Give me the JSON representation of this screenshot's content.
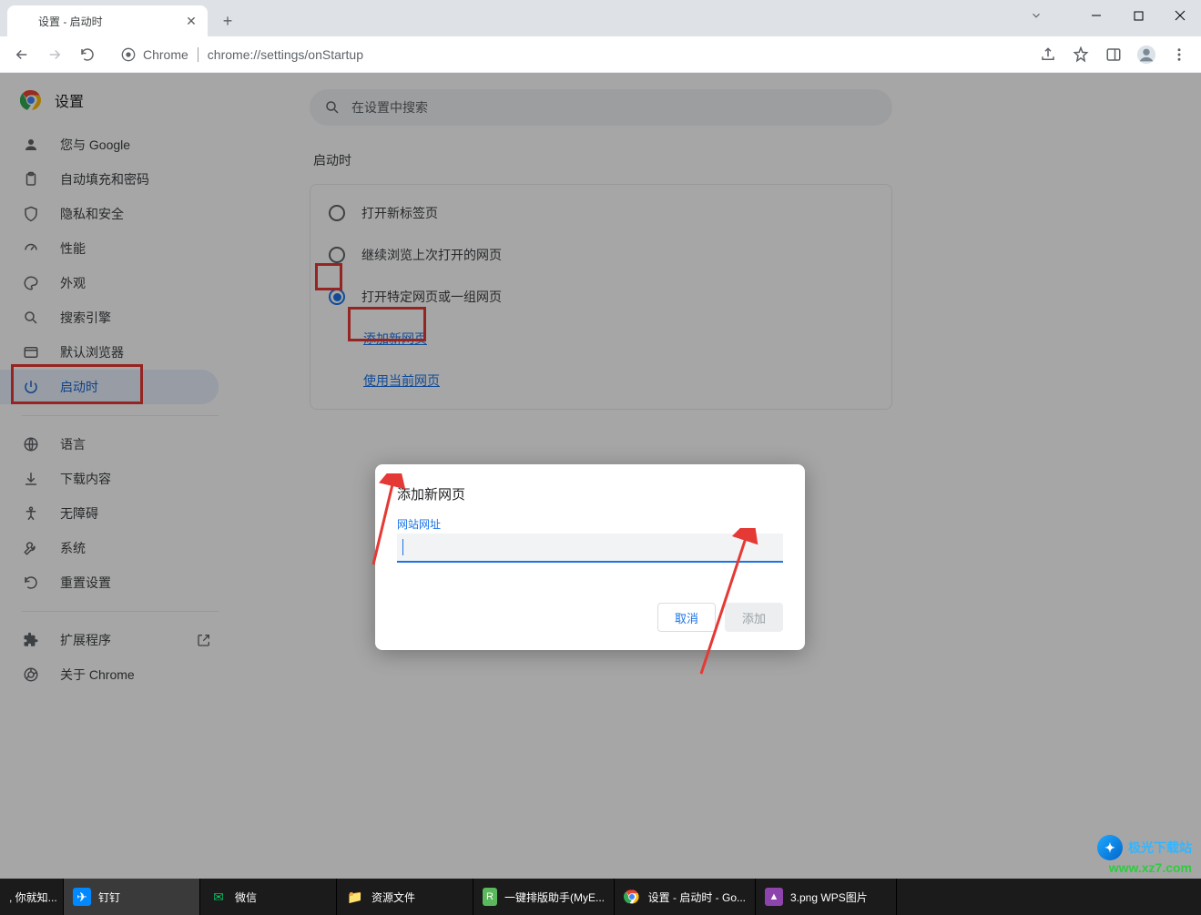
{
  "window": {
    "tab_title": "设置 - 启动时",
    "chrome_label": "Chrome",
    "url": "chrome://settings/onStartup"
  },
  "settings_header": "设置",
  "search_placeholder": "在设置中搜索",
  "sidebar": {
    "items": [
      {
        "label": "您与 Google"
      },
      {
        "label": "自动填充和密码"
      },
      {
        "label": "隐私和安全"
      },
      {
        "label": "性能"
      },
      {
        "label": "外观"
      },
      {
        "label": "搜索引擎"
      },
      {
        "label": "默认浏览器"
      },
      {
        "label": "启动时"
      }
    ],
    "items2": [
      {
        "label": "语言"
      },
      {
        "label": "下载内容"
      },
      {
        "label": "无障碍"
      },
      {
        "label": "系统"
      },
      {
        "label": "重置设置"
      }
    ],
    "items3": [
      {
        "label": "扩展程序"
      },
      {
        "label": "关于 Chrome"
      }
    ]
  },
  "main": {
    "section_title": "启动时",
    "options": [
      {
        "label": "打开新标签页"
      },
      {
        "label": "继续浏览上次打开的网页"
      },
      {
        "label": "打开特定网页或一组网页"
      }
    ],
    "links": {
      "add_page": "添加新网页",
      "use_current": "使用当前网页"
    }
  },
  "dialog": {
    "title": "添加新网页",
    "field_label": "网站网址",
    "input_value": "",
    "cancel": "取消",
    "confirm": "添加"
  },
  "taskbar": {
    "first": ", 你就知...",
    "items": [
      {
        "label": "钉钉",
        "color": "#0089ff"
      },
      {
        "label": "微信",
        "color": "#07c160"
      },
      {
        "label": "资源文件",
        "color": "#ffc94a"
      },
      {
        "label": "一键排版助手(MyE...",
        "color": "#5cb85c"
      },
      {
        "label": "设置 - 启动时 - Go...",
        "color": "#4285f4"
      },
      {
        "label": "3.png  WPS图片",
        "color": "#8e44ad"
      }
    ]
  },
  "watermark": {
    "brand": "极光下载站",
    "url": "www.xz7.com"
  }
}
